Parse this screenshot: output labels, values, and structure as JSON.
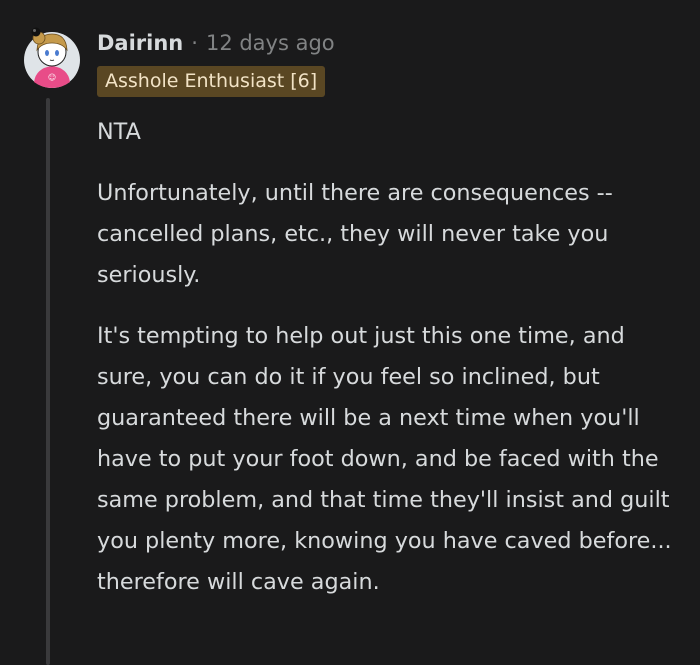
{
  "comment": {
    "username": "Dairinn",
    "separator": "·",
    "timestamp": "12 days ago",
    "flair": "Asshole Enthusiast [6]",
    "paragraphs": [
      "NTA",
      "Unfortunately, until there are consequences -- cancelled plans, etc., they will never take you seriously.",
      "It's tempting to help out just this one time, and sure, you can do it if you feel so inclined, but guaranteed there will be a next time when you'll have to put your foot down, and be faced with the same problem, and that time they'll insist and guilt you plenty more, knowing you have caved before... therefore will cave again."
    ]
  },
  "colors": {
    "background": "#1a1a1b",
    "text": "#d7dadc",
    "meta_text": "#818384",
    "flair_background": "#5a4723",
    "flair_text": "#f2e3c6",
    "thread_line": "#3a3a3c",
    "avatar_shirt": "#e84c88"
  },
  "icons": {
    "avatar": "user-avatar-icon"
  }
}
